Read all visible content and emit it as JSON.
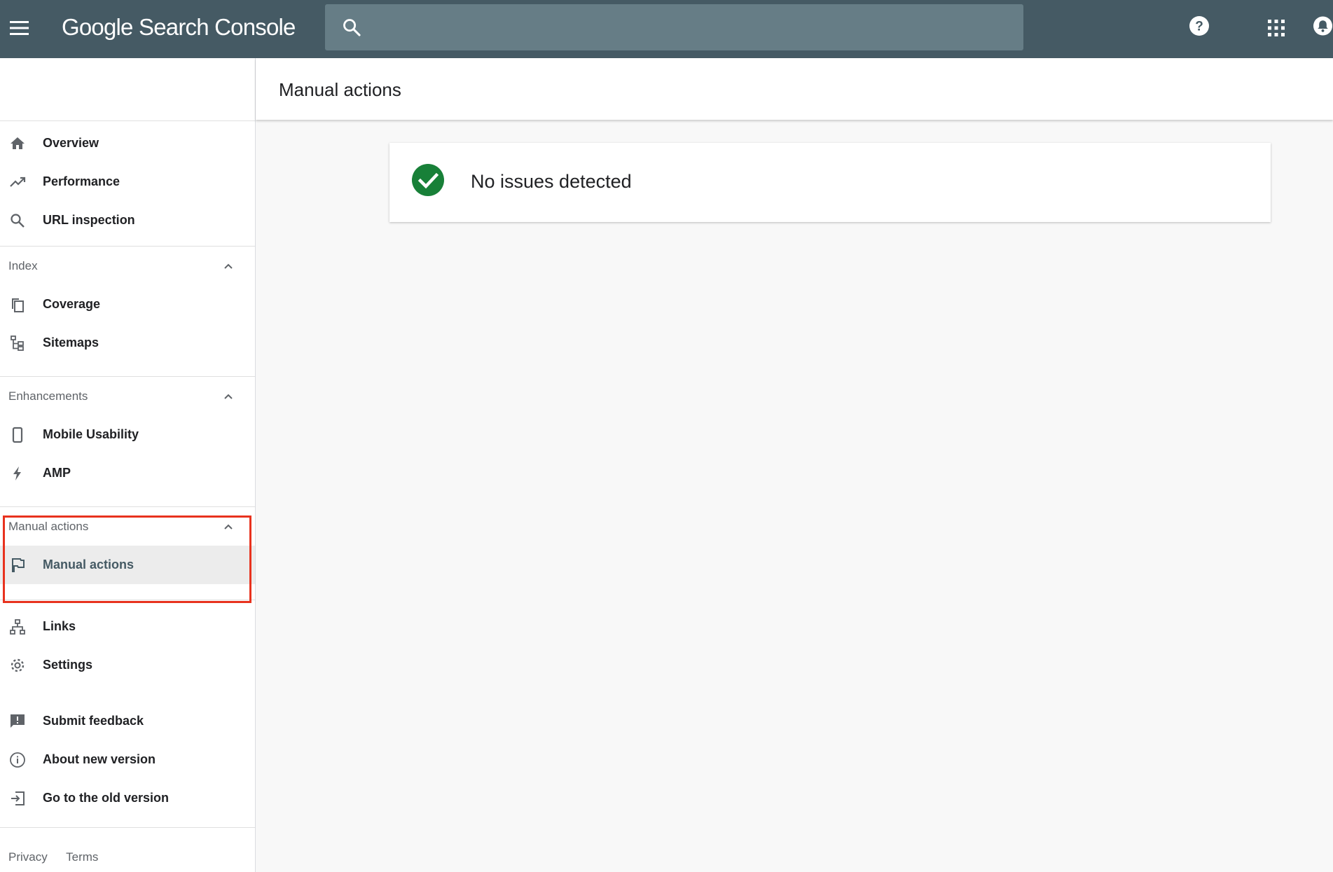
{
  "app": {
    "title_part1": "Google",
    "title_part2": "Search Console"
  },
  "search": {
    "value": "",
    "placeholder": ""
  },
  "header_icons": [
    "menu-icon",
    "search-icon",
    "help-icon",
    "apps-grid-icon",
    "notifications-icon"
  ],
  "sidebar": {
    "top_items": [
      {
        "label": "Overview",
        "icon": "home-icon"
      },
      {
        "label": "Performance",
        "icon": "trending-up-icon"
      },
      {
        "label": "URL inspection",
        "icon": "search-icon"
      }
    ],
    "index": {
      "title": "Index",
      "items": [
        {
          "label": "Coverage",
          "icon": "copy-pages-icon"
        },
        {
          "label": "Sitemaps",
          "icon": "sitemap-icon"
        }
      ]
    },
    "enhancements": {
      "title": "Enhancements",
      "items": [
        {
          "label": "Mobile Usability",
          "icon": "phone-icon"
        },
        {
          "label": "AMP",
          "icon": "bolt-icon"
        }
      ]
    },
    "manual_actions": {
      "title": "Manual actions",
      "items": [
        {
          "label": "Manual actions",
          "icon": "flag-icon",
          "active": true
        }
      ]
    },
    "other_items": [
      {
        "label": "Links",
        "icon": "links-network-icon"
      },
      {
        "label": "Settings",
        "icon": "gear-icon"
      }
    ],
    "bottom_items": [
      {
        "label": "Submit feedback",
        "icon": "feedback-icon"
      },
      {
        "label": "About new version",
        "icon": "info-icon"
      },
      {
        "label": "Go to the old version",
        "icon": "exit-icon"
      }
    ],
    "footer": {
      "privacy": "Privacy",
      "terms": "Terms"
    }
  },
  "main": {
    "page_title": "Manual actions",
    "status_message": "No issues detected",
    "status_color": "#188038"
  },
  "colors": {
    "topbar": "#455a64",
    "highlight_box": "#e8321e"
  }
}
